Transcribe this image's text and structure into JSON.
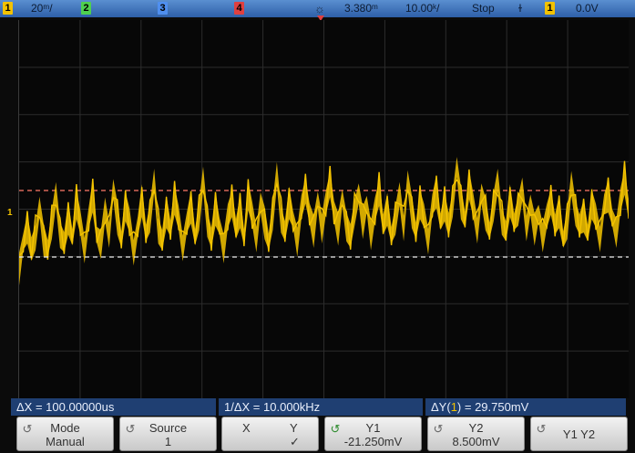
{
  "status_bar": {
    "ch1_label": "1",
    "ch1_scale": "20",
    "ch1_scale_suffix": "ᵐ/",
    "ch2_label": "2",
    "ch3_label": "3",
    "ch4_label": "4",
    "trigger_delay": "3.380",
    "trigger_delay_suffix": "ᵐ",
    "timebase": "10.00",
    "timebase_suffix": "ᵏ/",
    "run_state": "Stop",
    "trigger_source": "1",
    "trigger_level": "0.0V",
    "colors": {
      "ch1": "#f2c200",
      "ch2": "#4fd04f",
      "ch3": "#4f8ff0",
      "ch4": "#e04040",
      "bar": "#3d70bb"
    }
  },
  "screen": {
    "channel_marker": "1",
    "trace_color": "#f5c400",
    "cursor_y1_color": "#e9e9e9",
    "cursor_y2_color": "#ff7a6a"
  },
  "readouts": {
    "delta_x": "ΔX = 100.00000us",
    "inverse_delta_x": "1/ΔX = 10.000kHz",
    "delta_y_prefix": "ΔY(",
    "delta_y_channel": "1",
    "delta_y_suffix": ") = 29.750mV"
  },
  "softkeys": [
    {
      "top": "Mode",
      "bottom": "Manual",
      "icon": "knob-icon"
    },
    {
      "top": "Source",
      "bottom": "1",
      "icon": "knob-icon"
    },
    {
      "top": "X",
      "top2": "Y",
      "bottom": "✓"
    },
    {
      "top": "Y1",
      "bottom": "-21.250mV",
      "icon": "knob-active-icon"
    },
    {
      "top": "Y2",
      "bottom": "8.500mV",
      "icon": "knob-icon"
    },
    {
      "top": "Y1 Y2",
      "icon": "knob-icon"
    }
  ],
  "chart_data": {
    "type": "line",
    "title": "",
    "xlabel": "",
    "ylabel": "",
    "grid": true,
    "x_divisions": 10,
    "y_divisions": 8,
    "series": [
      {
        "values": [
          -0.3,
          0.9,
          1.6,
          0.4,
          1.3,
          2.4,
          1.0,
          0.6,
          1.8,
          2.9,
          1.4,
          0.8,
          2.0,
          1.1,
          2.7,
          1.6,
          0.7,
          1.9,
          3.0,
          1.2,
          0.9,
          2.2,
          1.4,
          3.2,
          2.0,
          1.0,
          2.6,
          1.7,
          0.6,
          1.5,
          2.8,
          1.3,
          2.1,
          3.5,
          1.6,
          0.9,
          2.3,
          1.5,
          2.9,
          1.8,
          0.8,
          1.7,
          2.5,
          1.1,
          2.2,
          3.6,
          1.9,
          1.0,
          2.4,
          1.6,
          0.7,
          1.9,
          2.8,
          1.4,
          2.3,
          1.1,
          3.1,
          2.0,
          1.2,
          2.6,
          1.8,
          0.9,
          2.2,
          3.8,
          2.1,
          1.3,
          2.7,
          1.9,
          1.0,
          2.3,
          3.4,
          2.1,
          1.4,
          2.8,
          1.6,
          2.5,
          3.7,
          2.2,
          1.5,
          2.9,
          1.7,
          1.0,
          2.4,
          3.0,
          1.8,
          2.6,
          1.3,
          2.2,
          3.3,
          1.6,
          2.4,
          1.2,
          2.0,
          2.9,
          1.7,
          3.6,
          2.3,
          1.4,
          2.7,
          1.9,
          1.1,
          2.5,
          3.2,
          1.8,
          2.6,
          1.5,
          2.8,
          4.2,
          2.7,
          1.9,
          3.6,
          2.4,
          1.6,
          3.0,
          2.2,
          1.4,
          2.6,
          3.5,
          2.0,
          1.3,
          2.8,
          1.8,
          2.4,
          3.1,
          1.7,
          2.5,
          1.5,
          2.2,
          1.2,
          1.9,
          2.9,
          1.6,
          2.3,
          1.0,
          1.8,
          3.4,
          2.4,
          1.6,
          2.1,
          1.3,
          2.7,
          1.9,
          1.2,
          2.5,
          3.0,
          2.0,
          1.4,
          2.6,
          3.8,
          2.3
        ]
      }
    ],
    "y_cursors": {
      "y1": "-21.250mV",
      "y2": "8.500mV"
    }
  }
}
